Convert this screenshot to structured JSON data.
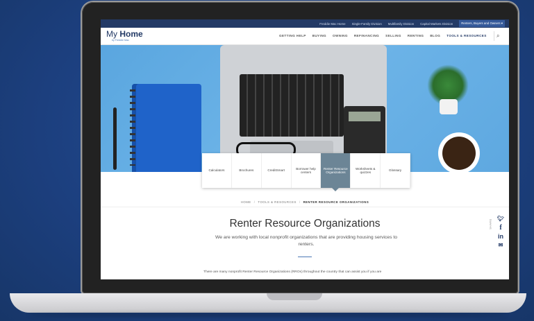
{
  "colors": {
    "navy": "#233a66",
    "accent": "#4b78b5",
    "active_tab": "#6c8596"
  },
  "topbar": {
    "links": [
      "Freddie Mac Home",
      "Single-Family Division",
      "Multifamily Division",
      "Capital Markets Division",
      "Renters, Buyers and Owners ▾"
    ]
  },
  "logo": {
    "word1": "My",
    "word2": "Home",
    "sub": "by Freddie Mac"
  },
  "nav": {
    "items": [
      "GETTING HELP",
      "BUYING",
      "OWNING",
      "REFINANCING",
      "SELLING",
      "RENTING",
      "BLOG",
      "TOOLS & RESOURCES"
    ],
    "active": "TOOLS & RESOURCES",
    "search_icon": "search-icon"
  },
  "tabs": [
    "Calculators",
    "Brochures",
    "CreditSmart",
    "Borrower help centers",
    "Renter Resource Organizations",
    "Worksheets & quizzes",
    "Glossary"
  ],
  "active_tab": "Renter Resource Organizations",
  "breadcrumb": {
    "home": "HOME",
    "section": "TOOLS & RESOURCES",
    "current": "RENTER RESOURCE ORGANIZATIONS"
  },
  "page": {
    "title": "Renter Resource Organizations",
    "subtitle": "We are working with local nonprofit organizations that are providing housing services to renters.",
    "body": "There are many nonprofit Renter Resource Organizations (RROs) throughout the country that can assist you if you are"
  },
  "share": {
    "label": "SHARE",
    "icons": [
      "twitter-icon",
      "facebook-icon",
      "linkedin-icon",
      "email-icon"
    ]
  }
}
